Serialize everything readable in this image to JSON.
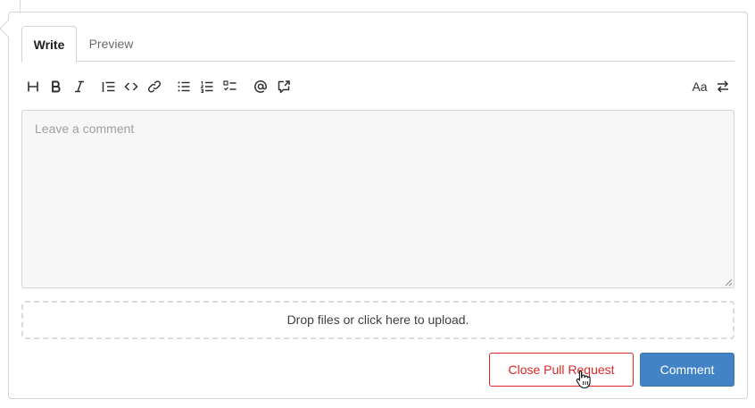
{
  "tabs": [
    {
      "label": "Write",
      "active": true
    },
    {
      "label": "Preview",
      "active": false
    }
  ],
  "toolbar": {
    "left_tools": [
      "heading-icon",
      "bold-icon",
      "italic-icon",
      "quote-icon",
      "code-icon",
      "link-icon",
      "unordered-list-icon",
      "ordered-list-icon",
      "task-list-icon",
      "mention-icon",
      "cross-reference-icon"
    ],
    "monospace_label": "Aa",
    "switch_editor_icon": "switch-arrows-icon"
  },
  "editor": {
    "placeholder": "Leave a comment",
    "value": ""
  },
  "dropzone": {
    "text": "Drop files or click here to upload."
  },
  "actions": {
    "close_label": "Close Pull Request",
    "comment_label": "Comment"
  },
  "colors": {
    "danger": "#db2828",
    "primary": "#4183c4",
    "border": "#d4d4d5"
  }
}
